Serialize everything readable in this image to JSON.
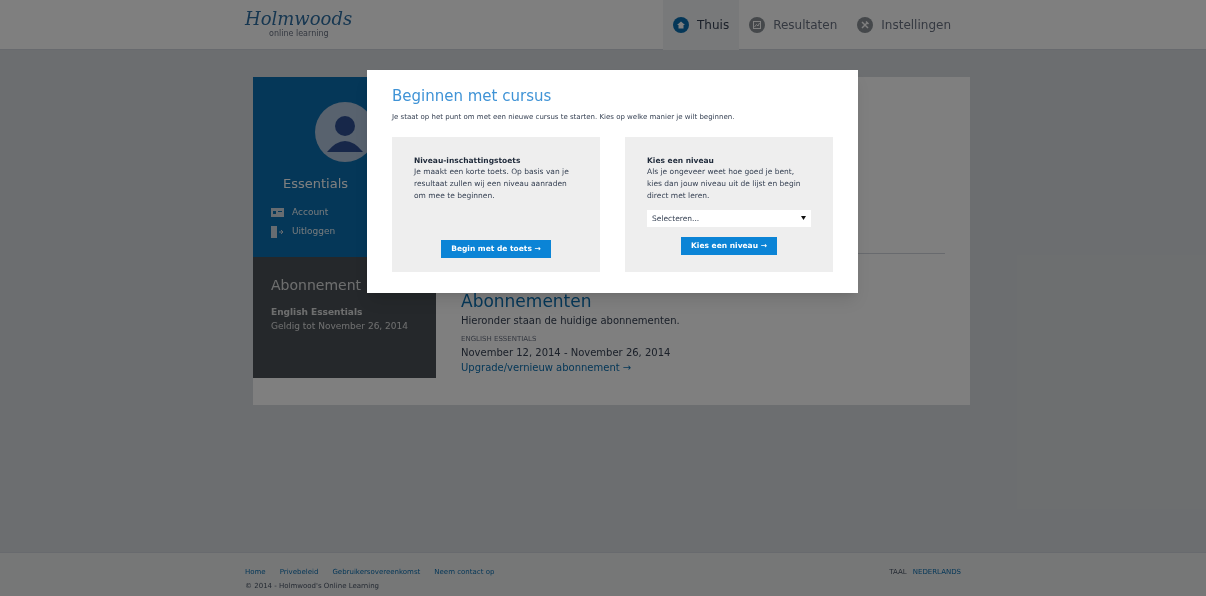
{
  "header": {
    "logo": "Holmwoods",
    "logo_tagline": "online learning",
    "nav": [
      {
        "label": "Thuis",
        "selected": true
      },
      {
        "label": "Resultaten",
        "selected": false
      },
      {
        "label": "Instellingen",
        "selected": false
      }
    ]
  },
  "sidebar": {
    "name": "Essentials",
    "links": [
      "Account",
      "Uitloggen"
    ],
    "subscriptions_title": "Abonnement",
    "subscription_name": "English Essentials",
    "subscription_valid": "Geldig tot November 26, 2014"
  },
  "main": {
    "heading": "Abonnementen",
    "intro": "Hieronder staan de huidige abonnementen.",
    "item_label": "ENGLISH ESSENTIALS",
    "item_dates": "November 12, 2014 - November 26, 2014",
    "item_link": "Upgrade/vernieuw abonnement →"
  },
  "modal": {
    "title": "Beginnen met cursus",
    "intro": "Je staat op het punt om met een nieuwe cursus te starten. Kies op welke manier je wilt beginnen.",
    "options": [
      {
        "kind": "test",
        "title": "Niveau-inschattingstoets",
        "text": "Je maakt een korte toets. Op basis van je resultaat zullen wij een niveau aanraden om mee te beginnen.",
        "button": "Begin met de toets →"
      },
      {
        "kind": "select",
        "title": "Kies een niveau",
        "text": "Als je ongeveer weet hoe goed je bent, kies dan jouw niveau uit de lijst en begin direct met leren.",
        "select_placeholder": "Selecteren...",
        "button": "Kies een niveau →"
      }
    ]
  },
  "footer": {
    "links": [
      "Home",
      "Privebeleid",
      "Gebruikersovereenkomst",
      "Neem contact op"
    ],
    "copyright": "© 2014 - Holmwood's Online Learning",
    "language_label": "TAAL",
    "language": "NEDERLANDS"
  }
}
